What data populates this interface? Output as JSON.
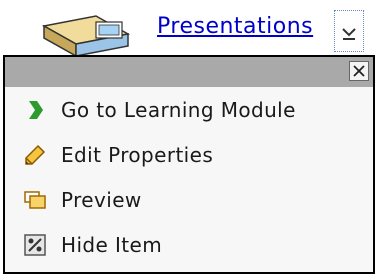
{
  "breadcrumb": {
    "link_text": "Presentations"
  },
  "menu": {
    "items": [
      {
        "label": "Go to Learning Module",
        "icon": "green-chevron-icon"
      },
      {
        "label": "Edit Properties",
        "icon": "pencil-icon"
      },
      {
        "label": "Preview",
        "icon": "preview-window-icon"
      },
      {
        "label": "Hide Item",
        "icon": "hide-item-icon"
      }
    ]
  },
  "colors": {
    "link": "#0000cc",
    "menu_header": "#a9a9a9",
    "chevron": "#2e9a2e"
  }
}
